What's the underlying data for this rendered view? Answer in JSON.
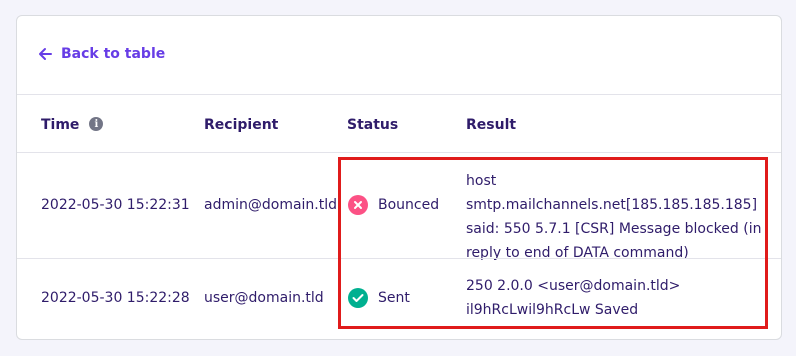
{
  "back_link": {
    "label": "Back to table",
    "icon": "arrow-left-icon"
  },
  "table": {
    "headers": {
      "time": "Time",
      "recipient": "Recipient",
      "status": "Status",
      "result": "Result"
    },
    "rows": [
      {
        "time": "2022-05-30 15:22:31",
        "recipient": "admin@domain.tld",
        "status": "Bounced",
        "status_icon": "close-circle-icon",
        "status_color": "#fc5185",
        "result_lines": [
          "host smtp.mailchannels.net[185.185.185.185]",
          "said: 550 5.7.1 [CSR] Message blocked (in",
          "reply to end of DATA command)"
        ]
      },
      {
        "time": "2022-05-30 15:22:28",
        "recipient": "user@domain.tld",
        "status": "Sent",
        "status_icon": "check-circle-icon",
        "status_color": "#00b090",
        "result_lines": [
          "250 2.0.0 <user@domain.tld>",
          "il9hRcLwil9hRcLw Saved"
        ]
      }
    ]
  },
  "colors": {
    "accent": "#673de6",
    "text": "#2f1c6a",
    "highlight": "#e01b1b"
  }
}
